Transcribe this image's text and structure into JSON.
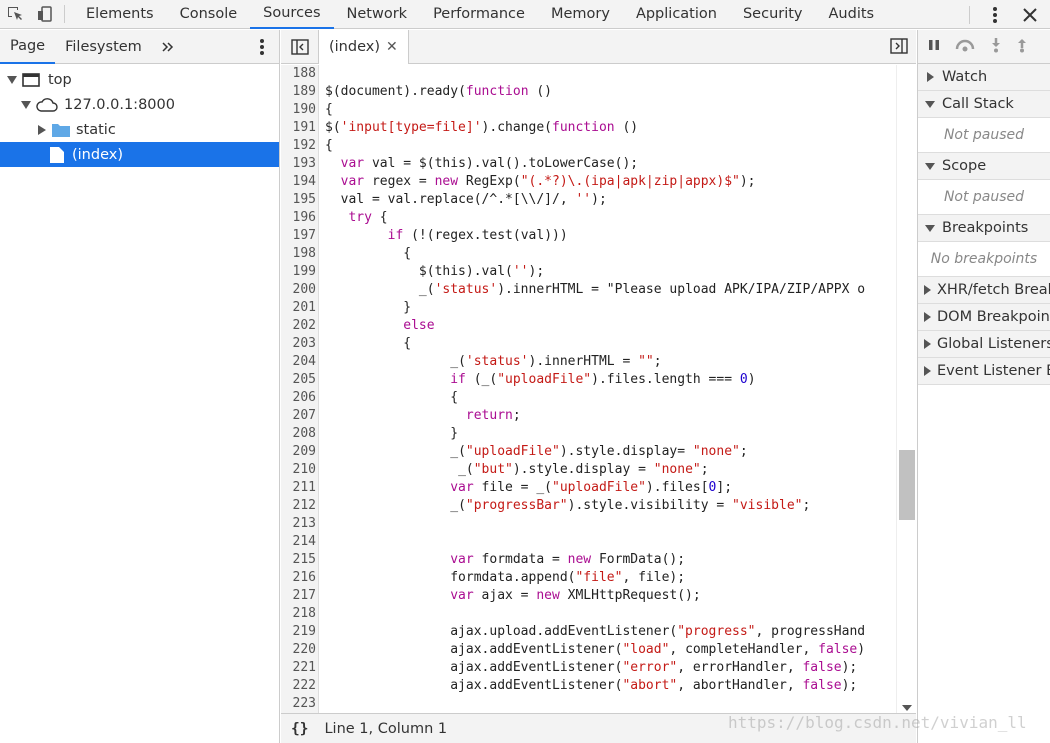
{
  "main_tabs": [
    "Elements",
    "Console",
    "Sources",
    "Network",
    "Performance",
    "Memory",
    "Application",
    "Security",
    "Audits"
  ],
  "active_main_tab": "Sources",
  "left_panel": {
    "tabs": [
      "Page",
      "Filesystem"
    ],
    "active_tab": "Page",
    "tree": [
      {
        "label": "top",
        "expanded": true,
        "icon": "frame-icon"
      },
      {
        "label": "127.0.0.1:8000",
        "expanded": true,
        "icon": "cloud-icon"
      },
      {
        "label": "static",
        "expanded": false,
        "icon": "folder-icon"
      },
      {
        "label": "(index)",
        "selected": true,
        "icon": "file-icon"
      }
    ]
  },
  "editor": {
    "tab_label": "(index)",
    "lines": [
      {
        "n": "188",
        "code": ""
      },
      {
        "n": "189",
        "code": "$(document).ready(function ()"
      },
      {
        "n": "190",
        "code": "{"
      },
      {
        "n": "191",
        "code": "$('input[type=file]').change(function ()"
      },
      {
        "n": "192",
        "code": "{"
      },
      {
        "n": "193",
        "code": "  var val = $(this).val().toLowerCase();"
      },
      {
        "n": "194",
        "code": "  var regex = new RegExp(\"(.*?)\\.(ipa|apk|zip|appx)$\");"
      },
      {
        "n": "195",
        "code": "  val = val.replace(/^.*[\\\\/]/, '');"
      },
      {
        "n": "196",
        "code": "   try {"
      },
      {
        "n": "197",
        "code": "        if (!(regex.test(val)))"
      },
      {
        "n": "198",
        "code": "          {"
      },
      {
        "n": "199",
        "code": "            $(this).val('');"
      },
      {
        "n": "200",
        "code": "            _('status').innerHTML = \"Please upload APK/IPA/ZIP/APPX o"
      },
      {
        "n": "201",
        "code": "          }"
      },
      {
        "n": "202",
        "code": "          else"
      },
      {
        "n": "203",
        "code": "          {"
      },
      {
        "n": "204",
        "code": "                _('status').innerHTML = \"\";"
      },
      {
        "n": "205",
        "code": "                if (_(\"uploadFile\").files.length === 0)"
      },
      {
        "n": "206",
        "code": "                {"
      },
      {
        "n": "207",
        "code": "                  return;"
      },
      {
        "n": "208",
        "code": "                }"
      },
      {
        "n": "209",
        "code": "                _(\"uploadFile\").style.display= \"none\";"
      },
      {
        "n": "210",
        "code": "                 _(\"but\").style.display = \"none\";"
      },
      {
        "n": "211",
        "code": "                var file = _(\"uploadFile\").files[0];"
      },
      {
        "n": "212",
        "code": "                _(\"progressBar\").style.visibility = \"visible\";"
      },
      {
        "n": "213",
        "code": ""
      },
      {
        "n": "214",
        "code": ""
      },
      {
        "n": "215",
        "code": "                var formdata = new FormData();"
      },
      {
        "n": "216",
        "code": "                formdata.append(\"file\", file);"
      },
      {
        "n": "217",
        "code": "                var ajax = new XMLHttpRequest();"
      },
      {
        "n": "218",
        "code": ""
      },
      {
        "n": "219",
        "code": "                ajax.upload.addEventListener(\"progress\", progressHand"
      },
      {
        "n": "220",
        "code": "                ajax.addEventListener(\"load\", completeHandler, false)"
      },
      {
        "n": "221",
        "code": "                ajax.addEventListener(\"error\", errorHandler, false);"
      },
      {
        "n": "222",
        "code": "                ajax.addEventListener(\"abort\", abortHandler, false);"
      },
      {
        "n": "223",
        "code": ""
      }
    ]
  },
  "status_bar": {
    "braces": "{}",
    "position": "Line 1, Column 1"
  },
  "right_panel": {
    "panes": [
      {
        "label": "Watch"
      },
      {
        "label": "Call Stack",
        "body": "Not paused"
      },
      {
        "label": "Scope",
        "body": "Not paused"
      },
      {
        "label": "Breakpoints",
        "body": "No breakpoints"
      },
      {
        "label": "XHR/fetch Breakpoints"
      },
      {
        "label": "DOM Breakpoints"
      },
      {
        "label": "Global Listeners"
      },
      {
        "label": "Event Listener Breakpoints"
      }
    ]
  },
  "watermark": "https://blog.csdn.net/vivian_ll",
  "colors": {
    "accent": "#1a73e8",
    "keyword": "#aa0d91",
    "string": "#c41a16",
    "number": "#1c00cf"
  }
}
